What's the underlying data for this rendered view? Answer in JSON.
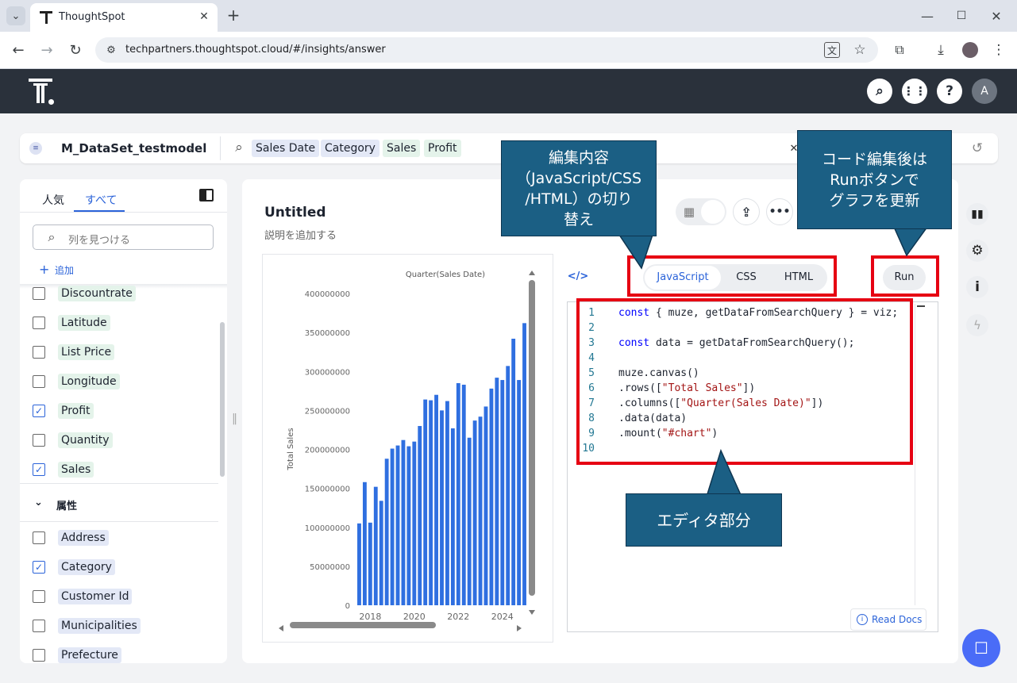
{
  "browser": {
    "tab_title": "ThoughtSpot",
    "url": "techpartners.thoughtspot.cloud/#/insights/answer"
  },
  "header": {
    "avatar": "A"
  },
  "search": {
    "datasource": "M_DataSet_testmodel",
    "tokens": [
      {
        "label": "Sales Date",
        "type": "a"
      },
      {
        "label": "Category",
        "type": "a"
      },
      {
        "label": "Sales",
        "type": "m"
      },
      {
        "label": "Profit",
        "type": "m"
      }
    ]
  },
  "left": {
    "tab_popular": "人気",
    "tab_all": "すべて",
    "find_placeholder": "列を見つける",
    "add_label": "追加",
    "attr_section": "属性",
    "measures": [
      {
        "label": "Discountrate",
        "checked": false
      },
      {
        "label": "Latitude",
        "checked": false
      },
      {
        "label": "List Price",
        "checked": false
      },
      {
        "label": "Longitude",
        "checked": false
      },
      {
        "label": "Profit",
        "checked": true
      },
      {
        "label": "Quantity",
        "checked": false
      },
      {
        "label": "Sales",
        "checked": true
      }
    ],
    "attributes": [
      {
        "label": "Address",
        "checked": false
      },
      {
        "label": "Category",
        "checked": true
      },
      {
        "label": "Customer Id",
        "checked": false
      },
      {
        "label": "Municipalities",
        "checked": false
      },
      {
        "label": "Prefecture",
        "checked": false
      }
    ]
  },
  "answer": {
    "title": "Untitled",
    "description": "説明を追加する"
  },
  "editor": {
    "tabs": [
      "JavaScript",
      "CSS",
      "HTML"
    ],
    "active_tab": "JavaScript",
    "run_label": "Run",
    "read_docs": "Read Docs",
    "lines": [
      "const { muze, getDataFromSearchQuery } = viz;",
      "",
      "const data = getDataFromSearchQuery();",
      "",
      "muze.canvas()",
      ".rows([\"Total Sales\"])",
      ".columns([\"Quarter(Sales Date)\"])",
      ".data(data)",
      ".mount(\"#chart\")",
      ""
    ]
  },
  "chart_data": {
    "type": "bar",
    "title": "Quarter(Sales Date)",
    "xlabel": "",
    "ylabel": "Total Sales",
    "ylim": [
      0,
      400000000
    ],
    "yticks": [
      "0",
      "50000000",
      "100000000",
      "150000000",
      "200000000",
      "250000000",
      "300000000",
      "350000000",
      "400000000"
    ],
    "xticks": [
      "2018",
      "2020",
      "2022",
      "2024"
    ],
    "values": [
      105000000,
      158000000,
      106000000,
      152000000,
      134000000,
      188000000,
      201000000,
      205000000,
      212000000,
      204000000,
      210000000,
      230000000,
      264000000,
      263000000,
      270000000,
      250000000,
      262000000,
      227000000,
      285000000,
      283000000,
      215000000,
      237000000,
      242000000,
      255000000,
      278000000,
      292000000,
      289000000,
      307000000,
      342000000,
      289000000,
      362000000
    ]
  },
  "annotations": {
    "tab_switch": "編集内容\n（JavaScript/CSS\n/HTML）の切り\n替え",
    "run_note": "コード編集後は\nRunボタンで\nグラフを更新",
    "editor_note": "エディタ部分"
  },
  "colors": {
    "bar": "#2f6fe0",
    "annotation": "#1b5f84",
    "highlight": "#e60012"
  }
}
